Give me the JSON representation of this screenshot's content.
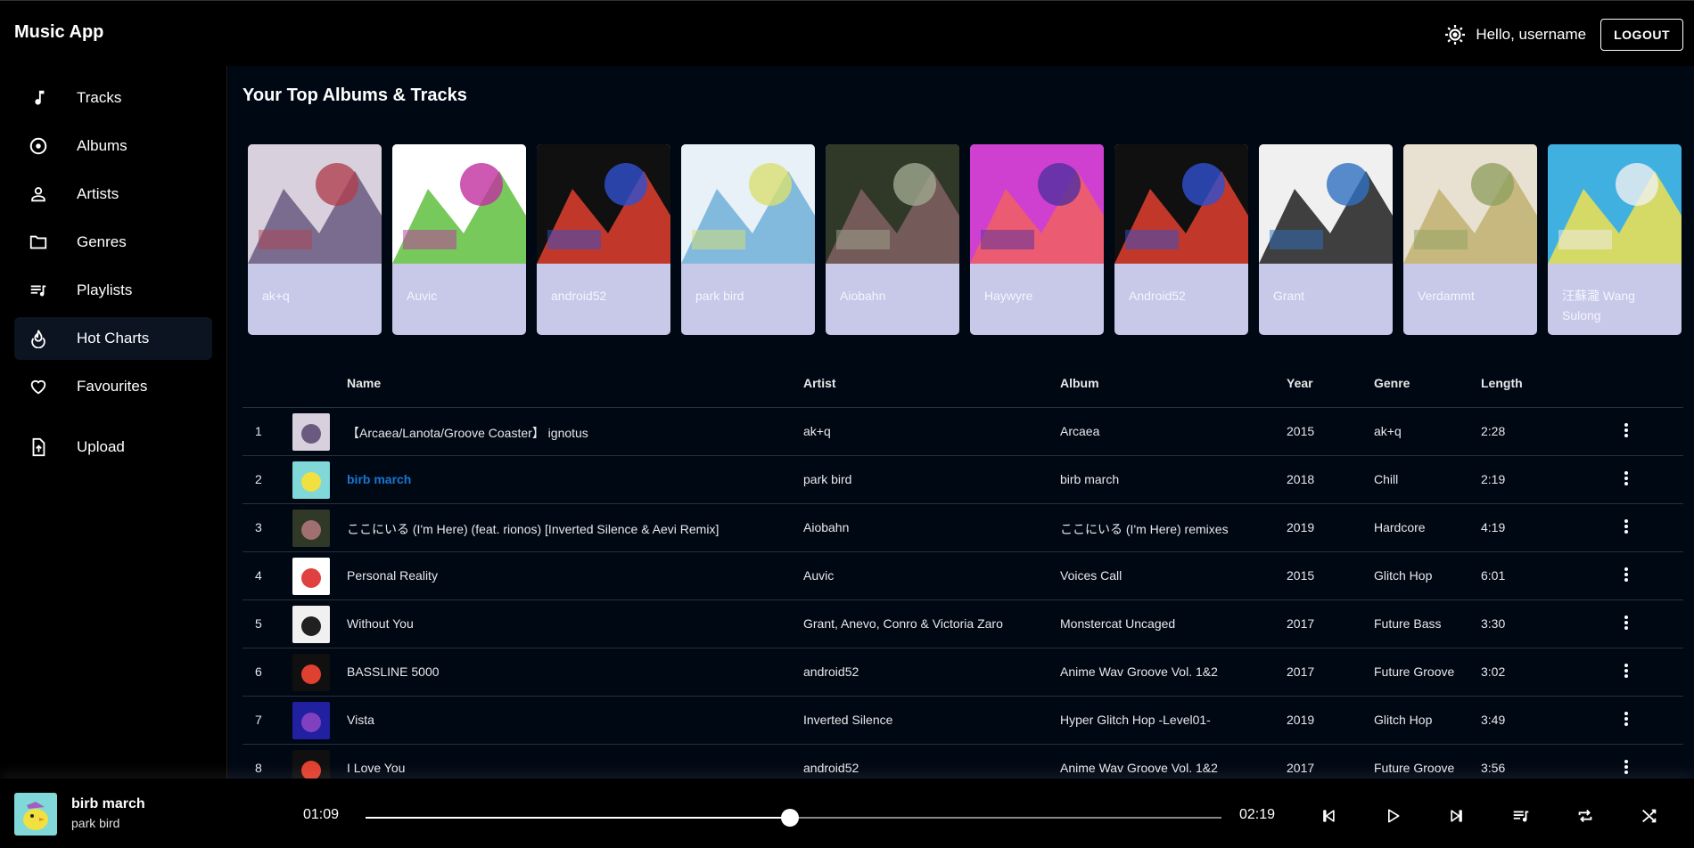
{
  "app": {
    "title": "Music App"
  },
  "header": {
    "greeting": "Hello, username",
    "logout_label": "LOGOUT"
  },
  "sidebar": {
    "items": [
      {
        "label": "Tracks",
        "icon": "music-note-icon"
      },
      {
        "label": "Albums",
        "icon": "disc-icon"
      },
      {
        "label": "Artists",
        "icon": "person-icon"
      },
      {
        "label": "Genres",
        "icon": "folder-icon"
      },
      {
        "label": "Playlists",
        "icon": "playlist-icon"
      },
      {
        "label": "Hot Charts",
        "icon": "fire-icon",
        "active": true
      },
      {
        "label": "Favourites",
        "icon": "heart-icon"
      },
      {
        "label": "Upload",
        "icon": "upload-file-icon"
      }
    ]
  },
  "main": {
    "section_title": "Your Top Albums & Tracks",
    "albums": [
      {
        "name": "ak+q",
        "colors": [
          "#d8d0dc",
          "#6a5a80",
          "#b04050"
        ]
      },
      {
        "name": "Auvic",
        "colors": [
          "#ffffff",
          "#60c040",
          "#c030a0"
        ]
      },
      {
        "name": "android52",
        "colors": [
          "#101010",
          "#e04030",
          "#3050d0"
        ]
      },
      {
        "name": "park bird",
        "colors": [
          "#e8f0f8",
          "#70b0d8",
          "#d8e070"
        ]
      },
      {
        "name": "Aiobahn",
        "colors": [
          "#303828",
          "#806060",
          "#a0a890"
        ]
      },
      {
        "name": "Haywyre",
        "colors": [
          "#d040d0",
          "#f06060",
          "#5030a0"
        ]
      },
      {
        "name": "Android52",
        "colors": [
          "#101010",
          "#e04030",
          "#3050d0"
        ]
      },
      {
        "name": "Grant",
        "colors": [
          "#f0f0f0",
          "#202020",
          "#3070c0"
        ]
      },
      {
        "name": "Verdammt",
        "colors": [
          "#e8e0d0",
          "#c0b070",
          "#90a060"
        ]
      },
      {
        "name": "汪蘇瀧 Wang Sulong",
        "colors": [
          "#40b0e0",
          "#f0e050",
          "#f0f0f0"
        ]
      }
    ],
    "table": {
      "headers": {
        "name": "Name",
        "artist": "Artist",
        "album": "Album",
        "year": "Year",
        "genre": "Genre",
        "length": "Length"
      },
      "rows": [
        {
          "num": "1",
          "name": "【Arcaea/Lanota/Groove Coaster】 ignotus",
          "artist": "ak+q",
          "album": "Arcaea",
          "year": "2015",
          "genre": "ak+q",
          "length": "2:28",
          "thumb": [
            "#d8d0dc",
            "#6a5a80"
          ]
        },
        {
          "num": "2",
          "name": "birb march",
          "artist": "park bird",
          "album": "birb march",
          "year": "2018",
          "genre": "Chill",
          "length": "2:19",
          "active": true,
          "thumb": [
            "#80d8d8",
            "#f0e040"
          ]
        },
        {
          "num": "3",
          "name": "ここにいる (I'm Here) (feat. rionos) [Inverted Silence & Aevi Remix]",
          "artist": "Aiobahn",
          "album": "ここにいる (I'm Here) remixes",
          "year": "2019",
          "genre": "Hardcore",
          "length": "4:19",
          "thumb": [
            "#303828",
            "#a07070"
          ]
        },
        {
          "num": "4",
          "name": "Personal Reality",
          "artist": "Auvic",
          "album": "Voices Call",
          "year": "2015",
          "genre": "Glitch Hop",
          "length": "6:01",
          "thumb": [
            "#ffffff",
            "#e04040"
          ]
        },
        {
          "num": "5",
          "name": "Without You",
          "artist": "Grant, Anevo, Conro & Victoria Zaro",
          "album": "Monstercat Uncaged",
          "year": "2017",
          "genre": "Future Bass",
          "length": "3:30",
          "thumb": [
            "#f0f0f0",
            "#202020"
          ]
        },
        {
          "num": "6",
          "name": "BASSLINE 5000",
          "artist": "android52",
          "album": "Anime Wav Groove Vol. 1&2",
          "year": "2017",
          "genre": "Future Groove",
          "length": "3:02",
          "thumb": [
            "#101010",
            "#e04030"
          ]
        },
        {
          "num": "7",
          "name": "Vista",
          "artist": "Inverted Silence",
          "album": "Hyper Glitch Hop -Level01-",
          "year": "2019",
          "genre": "Glitch Hop",
          "length": "3:49",
          "thumb": [
            "#2020a0",
            "#8040c0"
          ]
        },
        {
          "num": "8",
          "name": "I Love You",
          "artist": "android52",
          "album": "Anime Wav Groove Vol. 1&2",
          "year": "2017",
          "genre": "Future Groove",
          "length": "3:56",
          "thumb": [
            "#101010",
            "#e04030"
          ]
        }
      ]
    }
  },
  "player": {
    "title": "birb march",
    "artist": "park bird",
    "current_time": "01:09",
    "total_time": "02:19",
    "progress": 0.496
  },
  "colors": {
    "accent": "#1976d2",
    "card": "#c8c8e8",
    "main_bg": "#000814"
  }
}
